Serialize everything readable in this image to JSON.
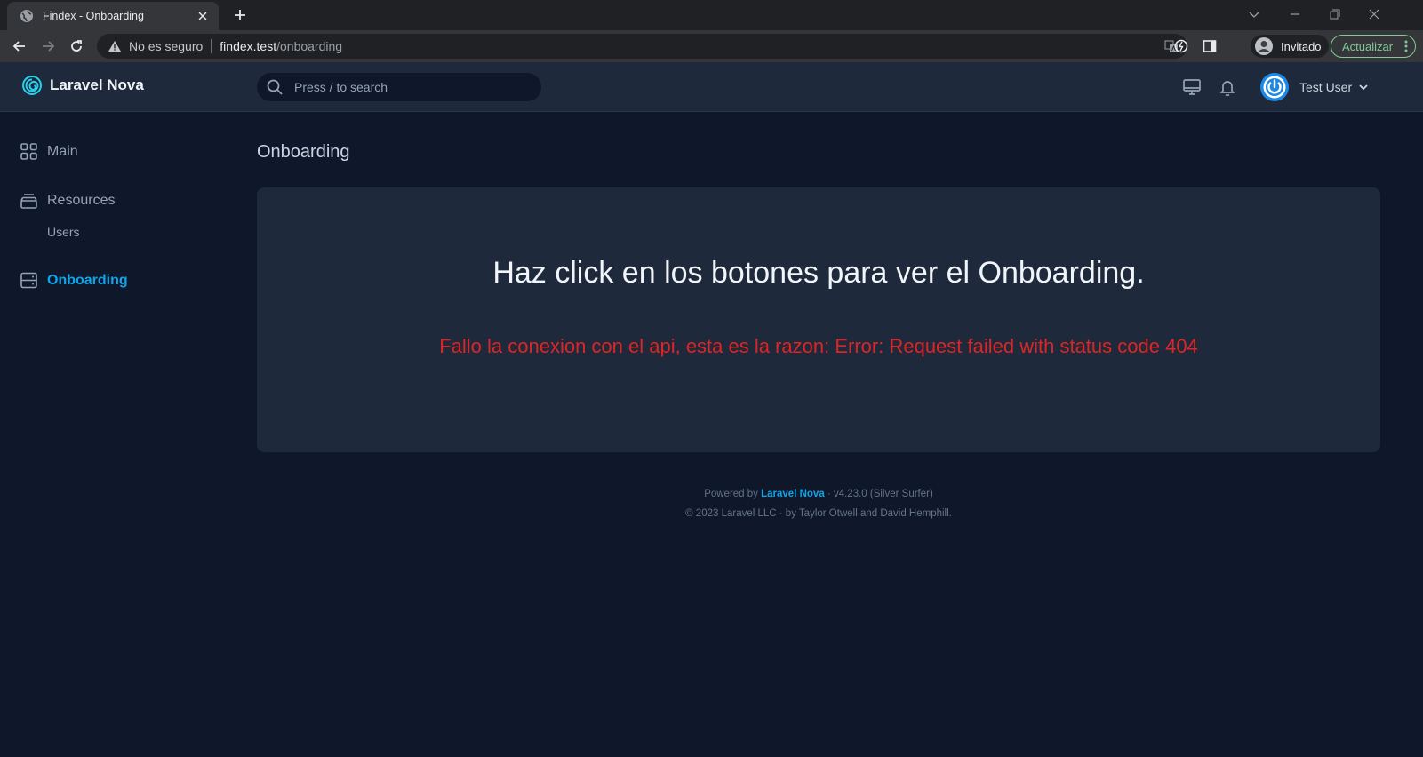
{
  "browser": {
    "tab_title": "Findex - Onboarding",
    "not_secure": "No es seguro",
    "url_host": "findex.test",
    "url_path": "/onboarding",
    "profile_name": "Invitado",
    "update_label": "Actualizar"
  },
  "header": {
    "brand": "Laravel Nova",
    "search_placeholder": "Press / to search",
    "user_name": "Test User"
  },
  "sidebar": {
    "items": [
      {
        "label": "Main",
        "icon": "grid-icon"
      },
      {
        "label": "Resources",
        "icon": "archive-icon"
      },
      {
        "label": "Onboarding",
        "icon": "server-icon",
        "active": true
      }
    ],
    "sub_items": [
      {
        "label": "Users"
      }
    ]
  },
  "main": {
    "page_title": "Onboarding",
    "heading": "Haz click en los botones para ver el Onboarding.",
    "error": "Fallo la conexion con el api, esta es la razon: Error: Request failed with status code 404"
  },
  "footer": {
    "powered_by": "Powered by",
    "link": "Laravel Nova",
    "version": "· v4.23.0 (Silver Surfer)",
    "copyright": "© 2023 Laravel LLC · by Taylor Otwell and David Hemphill."
  },
  "colors": {
    "accent": "#0ea5e9",
    "error": "#dc2626",
    "background": "#0f172a",
    "surface": "#1e293b"
  }
}
